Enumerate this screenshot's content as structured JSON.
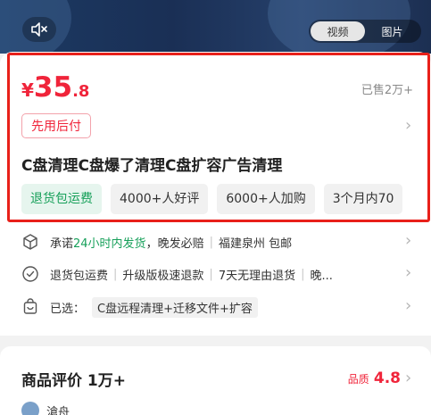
{
  "media_toggle": {
    "video": "视频",
    "image": "图片",
    "active": "video"
  },
  "product": {
    "price_symbol": "¥",
    "price_int": "35",
    "price_dec": ".8",
    "sold": "已售2万+",
    "pay_later": "先用后付",
    "title": "C盘清理C盘爆了清理C盘扩容广告清理",
    "tags": [
      "退货包运费",
      "4000+人好评",
      "6000+人加购",
      "3个月内70"
    ]
  },
  "services": {
    "promise_prefix": "承诺",
    "promise_highlight": "24小时内发货",
    "promise_rest": "，晚发必赔",
    "location": "福建泉州 包邮",
    "returns": [
      "退货包运费",
      "升级版极速退款",
      "7天无理由退货",
      "晚..."
    ],
    "selected_label": "已选：",
    "selected_value": "C盘远程清理+迁移文件+扩容"
  },
  "reviews": {
    "title": "商品评价 1万+",
    "quality_label": "品质",
    "quality_score": "4.8",
    "first_reviewer": "滄舟"
  },
  "colors": {
    "price_red": "#f0243a",
    "green": "#17a05a",
    "highlight_box": "#e8201a"
  }
}
